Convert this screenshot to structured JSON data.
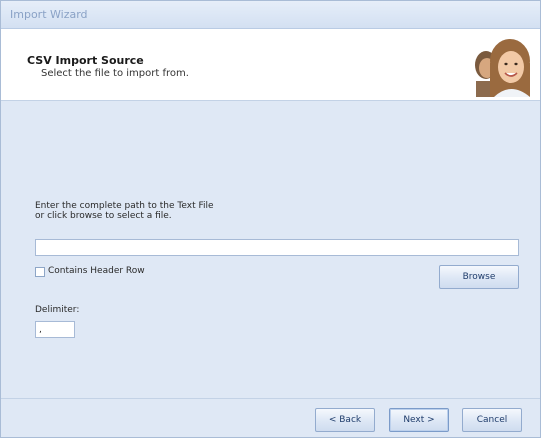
{
  "window": {
    "title": "Import Wizard"
  },
  "header": {
    "title": "CSV Import Source",
    "subtitle": "Select the file to import from."
  },
  "main": {
    "instruction_line1": "Enter the complete path to the Text File",
    "instruction_line2": "or click browse to select a file.",
    "path_input": {
      "value": "",
      "placeholder": ""
    },
    "header_row_checkbox": {
      "label": "Contains Header Row",
      "checked": false
    },
    "browse_label": "Browse",
    "delimiter_label": "Delimiter:",
    "delimiter_value": ","
  },
  "footer": {
    "back_label": "< Back",
    "next_label": "Next >",
    "cancel_label": "Cancel"
  }
}
